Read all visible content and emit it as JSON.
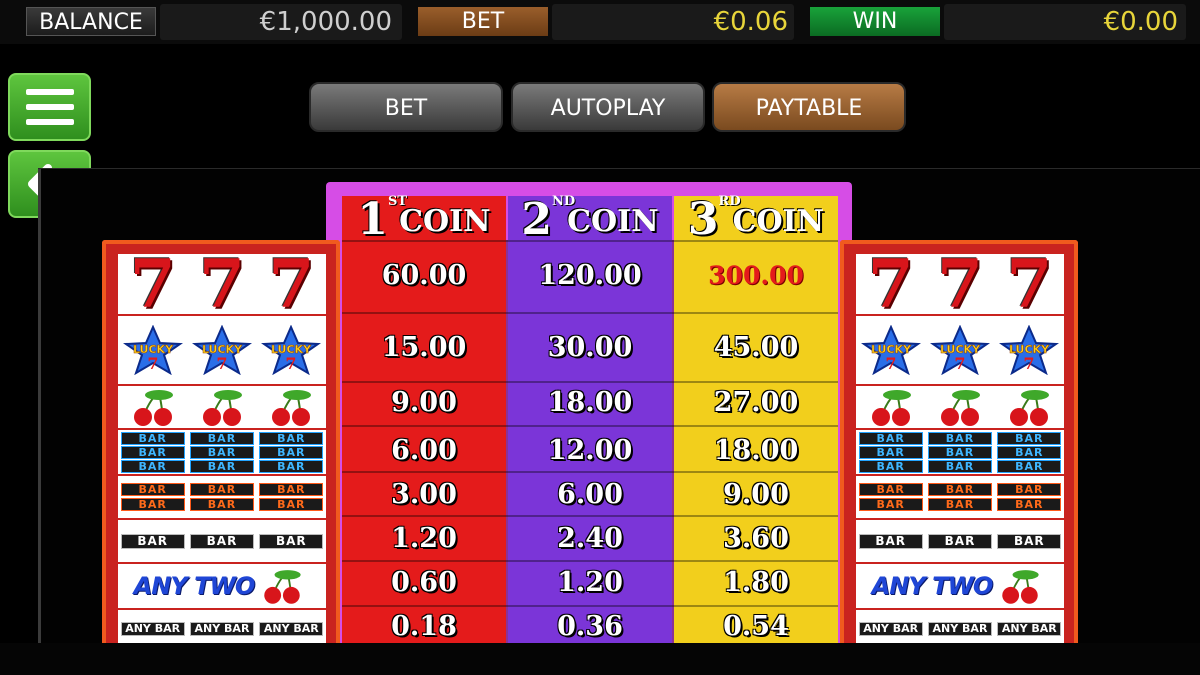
{
  "topbar": {
    "balance_label": "BALANCE",
    "balance_value": "€1,000.00",
    "bet_label": "BET",
    "bet_value": "€0.06",
    "win_label": "WIN",
    "win_value": "€0.00"
  },
  "side": {
    "menu_icon": "hamburger-menu-icon",
    "back_icon": "arrow-left-icon"
  },
  "tabs": {
    "bet": "BET",
    "autoplay": "AUTOPLAY",
    "paytable": "PAYTABLE",
    "active": "PAYTABLE"
  },
  "paytable": {
    "headers": [
      {
        "num": "1",
        "sup": "ST",
        "word": "COIN"
      },
      {
        "num": "2",
        "sup": "ND",
        "word": "COIN"
      },
      {
        "num": "3",
        "sup": "RD",
        "word": "COIN"
      }
    ],
    "symbols": [
      {
        "name": "triple-seven",
        "label": "777"
      },
      {
        "name": "lucky-seven",
        "label": "LUCKY"
      },
      {
        "name": "cherries",
        "label": ""
      },
      {
        "name": "triple-bar",
        "label": "BAR"
      },
      {
        "name": "double-bar",
        "label": "BAR"
      },
      {
        "name": "single-bar",
        "label": "BAR"
      },
      {
        "name": "any-two-cherries",
        "label": "ANY TWO"
      },
      {
        "name": "any-bar",
        "label": "ANY BAR"
      }
    ],
    "rows": [
      {
        "c1": "60.00",
        "c2": "120.00",
        "c3": "300.00"
      },
      {
        "c1": "15.00",
        "c2": "30.00",
        "c3": "45.00"
      },
      {
        "c1": "9.00",
        "c2": "18.00",
        "c3": "27.00"
      },
      {
        "c1": "6.00",
        "c2": "12.00",
        "c3": "18.00"
      },
      {
        "c1": "3.00",
        "c2": "6.00",
        "c3": "9.00"
      },
      {
        "c1": "1.20",
        "c2": "2.40",
        "c3": "3.60"
      },
      {
        "c1": "0.60",
        "c2": "1.20",
        "c3": "1.80"
      },
      {
        "c1": "0.18",
        "c2": "0.36",
        "c3": "0.54"
      }
    ]
  },
  "colors": {
    "coin1": "#e41b1b",
    "coin2": "#7b35d8",
    "coin3": "#f2cf1c",
    "frame": "#d64de6",
    "side_green": "#4bb52f",
    "paytable_tab": "#9b6433"
  }
}
